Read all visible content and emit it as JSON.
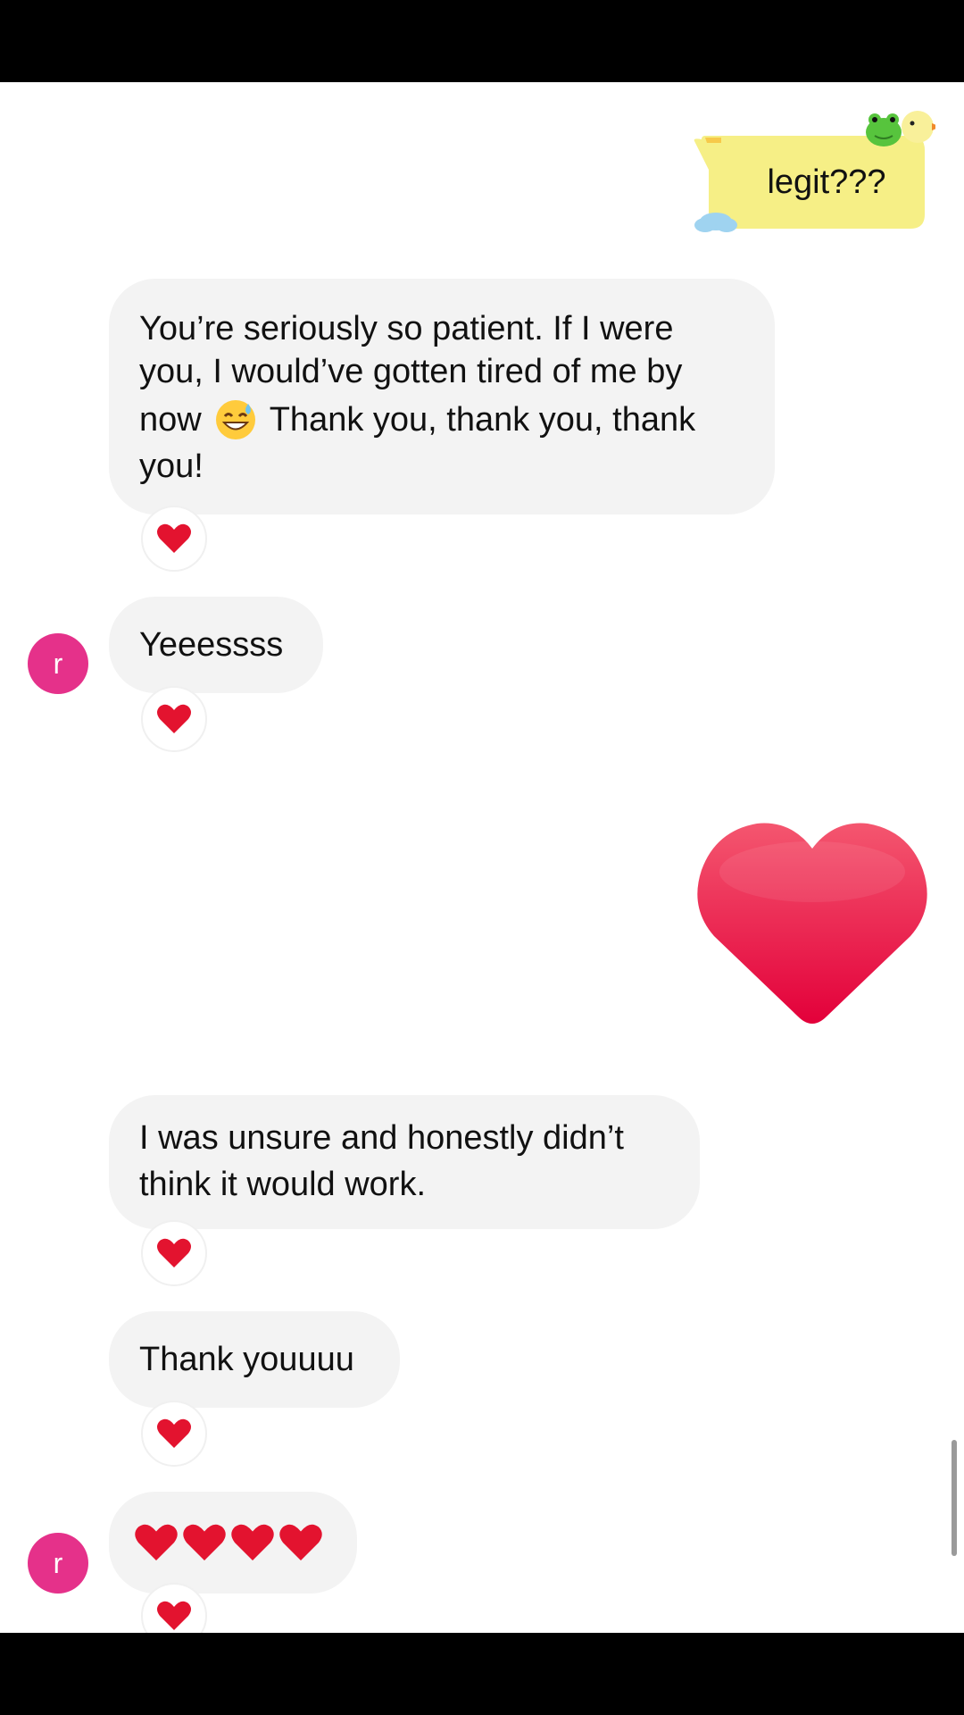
{
  "messages": {
    "m1": {
      "text": "legit???"
    },
    "m2": {
      "line1": "You’re seriously so patient. If I were",
      "line2": "you, I would’ve gotten tired of me by",
      "line3_pre": "now",
      "line3_post": "Thank you, thank you, thank",
      "line4": "you!"
    },
    "m3": {
      "text": "Yeeessss"
    },
    "m5": {
      "line1": "I was unsure and honestly didn’t",
      "line2": "think it would work."
    },
    "m6": {
      "text": "Thank youuuu"
    }
  },
  "avatar": {
    "initial": "r",
    "color": "#e5318a"
  },
  "colors": {
    "bubble_received": "#f3f3f3",
    "bubble_sent": "#f6ef86",
    "heart": "#e8143a"
  },
  "icons": {
    "reaction": "heart-icon",
    "emoji": "sweat-smile-emoji",
    "sticker": "frog-duck-sticker"
  }
}
